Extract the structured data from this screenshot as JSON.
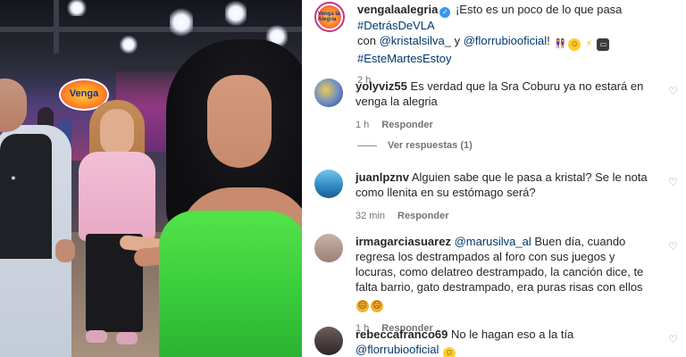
{
  "post": {
    "username": "vengalaalegria",
    "avatar_text": "Venga la Alegría",
    "caption_text_1": "¡Esto es un poco de lo que pasa ",
    "caption_hashtag_1": "#DetrásDeVLA",
    "caption_text_2": " con ",
    "caption_mention_1": "@kristalsilva_",
    "caption_text_3": " y ",
    "caption_mention_2": "@florrubiooficial",
    "caption_text_4": "!",
    "caption_hashtag_2": "#EsteMartesEstoy",
    "time": "2 h"
  },
  "comments": [
    {
      "username": "yolyviz55",
      "text": "Es verdad que la Sra Coburu ya no estará en venga la alegria",
      "time": "1 h",
      "reply_label": "Responder",
      "view_replies": "Ver respuestas (1)"
    },
    {
      "username": "juanlpznv",
      "text": "Alguien sabe que le pasa a kristal? Se le nota como llenita en su estómago será?",
      "time": "32 min",
      "reply_label": "Responder"
    },
    {
      "username": "irmagarciasuarez",
      "mention": "@marusilva_al",
      "text": " Buen día, cuando regresa los destrampados al foro con sus juegos y locuras, como delatreo destrampado, la canción dice, te falta barrio, gato destrampado, era puras risas con ellos",
      "time": "1 h",
      "reply_label": "Responder"
    },
    {
      "username": "rebeccafranco69",
      "text": "No le hagan eso a la tía ",
      "mention": "@florrubiooficial"
    }
  ],
  "media": {
    "stage_logo": "Venga"
  },
  "colors": {
    "link": "#00376b",
    "meta": "#737373",
    "verified": "#3897f0",
    "dress": "#3fd43f"
  },
  "icons": [
    "heart-icon",
    "verified-icon"
  ]
}
